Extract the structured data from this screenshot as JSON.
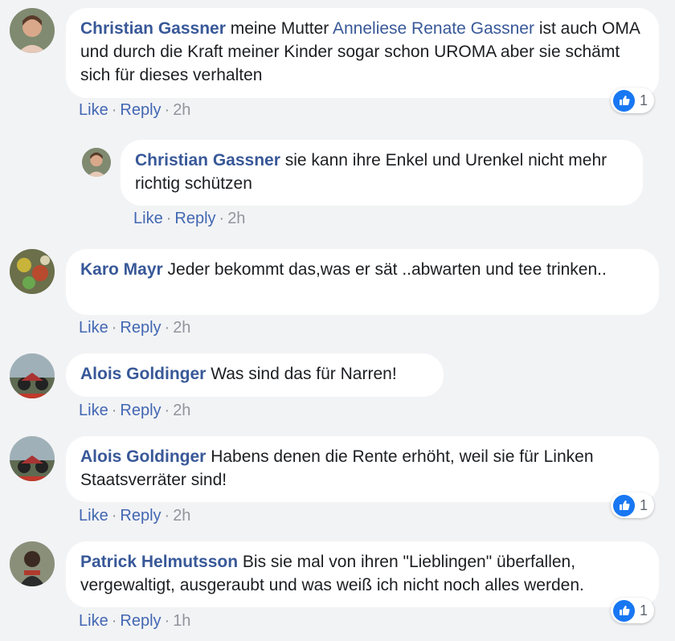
{
  "comments": [
    {
      "author": "Christian Gassner",
      "text_before": "meine Mutter",
      "mention": "Anneliese Renate Gassner",
      "text_after": "ist auch OMA und durch die Kraft meiner Kinder sogar schon UROMA aber sie schämt sich für dieses verhalten",
      "like": "Like",
      "reply": "Reply",
      "time": "2h",
      "reactions": "1"
    },
    {
      "author": "Christian Gassner",
      "text": "sie kann ihre Enkel und Urenkel nicht mehr richtig schützen",
      "like": "Like",
      "reply": "Reply",
      "time": "2h"
    },
    {
      "author": "Karo Mayr",
      "text": "Jeder bekommt das,was er sät ..abwarten und tee trinken..",
      "like": "Like",
      "reply": "Reply",
      "time": "2h"
    },
    {
      "author": "Alois Goldinger",
      "text": "Was sind das für Narren!",
      "like": "Like",
      "reply": "Reply",
      "time": "2h"
    },
    {
      "author": "Alois Goldinger",
      "text": "Habens denen die Rente erhöht, weil sie für Linken Staatsverräter sind!",
      "like": "Like",
      "reply": "Reply",
      "time": "2h",
      "reactions": "1"
    },
    {
      "author": "Patrick Helmutsson",
      "text": "Bis sie mal von ihren \"Lieblingen\" überfallen, vergewaltigt, ausgeraubt und was weiß ich nicht noch alles werden.",
      "like": "Like",
      "reply": "Reply",
      "time": "1h",
      "reactions": "1"
    }
  ],
  "separator": "·",
  "colors": {
    "background": "#f2f3f5",
    "author_link": "#385898",
    "action_link": "#4267b2",
    "like_badge": "#1877f2"
  },
  "icons": {
    "reaction": "thumbs-up-icon"
  }
}
